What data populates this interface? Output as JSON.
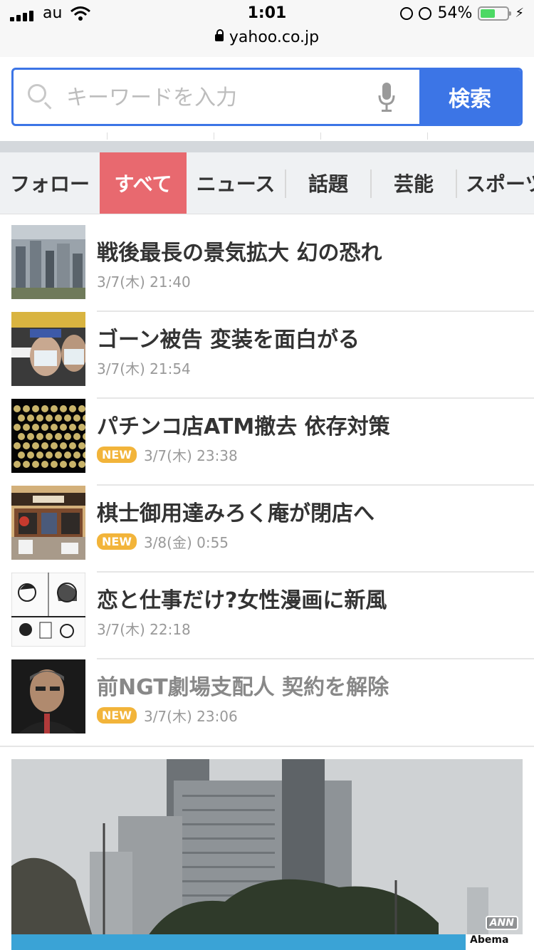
{
  "status": {
    "carrier": "au",
    "time": "1:01",
    "battery": "54%",
    "battery_level": 0.54,
    "url": "yahoo.co.jp"
  },
  "search": {
    "placeholder": "キーワードを入力",
    "button": "検索"
  },
  "tabs": [
    {
      "label": "フォロー",
      "active": false
    },
    {
      "label": "すべて",
      "active": true
    },
    {
      "label": "ニュース",
      "active": false
    },
    {
      "label": "話題",
      "active": false
    },
    {
      "label": "芸能",
      "active": false
    },
    {
      "label": "スポーツ",
      "active": false
    }
  ],
  "news": [
    {
      "title": "戦後最長の景気拡大 幻の恐れ",
      "date": "3/7(木) 21:40",
      "new": false,
      "visited": false
    },
    {
      "title": "ゴーン被告 変装を面白がる",
      "date": "3/7(木) 21:54",
      "new": false,
      "visited": false
    },
    {
      "title": "パチンコ店ATM撤去 依存対策",
      "date": "3/7(木) 23:38",
      "new": true,
      "visited": false
    },
    {
      "title": "棋士御用達みろく庵が閉店へ",
      "date": "3/8(金) 0:55",
      "new": true,
      "visited": false
    },
    {
      "title": "恋と仕事だけ?女性漫画に新風",
      "date": "3/7(木) 22:18",
      "new": false,
      "visited": false
    },
    {
      "title": "前NGT劇場支配人 契約を解除",
      "date": "3/7(木) 23:06",
      "new": true,
      "visited": true
    }
  ],
  "new_badge": "NEW",
  "feature": {
    "watermark": "ANN",
    "brand": "Abema"
  }
}
